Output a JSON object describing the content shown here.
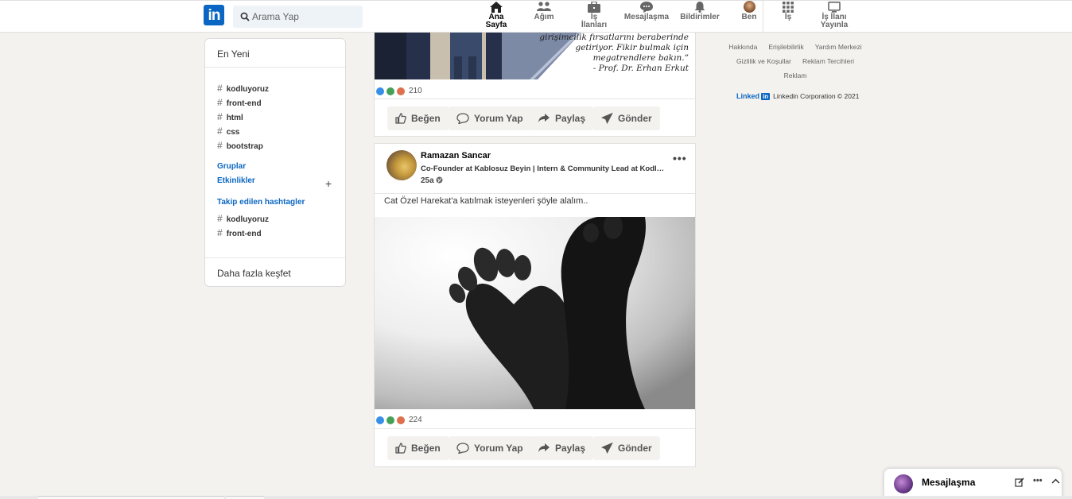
{
  "nav": {
    "logo": "in",
    "search_placeholder": "Arama Yap",
    "items": [
      {
        "label": "Ana Sayfa",
        "icon": "home-icon"
      },
      {
        "label": "Ağım",
        "icon": "network-icon"
      },
      {
        "label": "İş İlanları",
        "icon": "briefcase-icon"
      },
      {
        "label": "Mesajlaşma",
        "icon": "messaging-icon"
      },
      {
        "label": "Bildirimler",
        "icon": "bell-icon"
      },
      {
        "label": "Ben",
        "icon": "avatar"
      },
      {
        "label": "İş",
        "icon": "grid-icon"
      },
      {
        "label": "İş İlanı Yayınla",
        "icon": "post-job-icon"
      }
    ]
  },
  "sidebar": {
    "recent_label": "En Yeni",
    "recent_tags": [
      "kodluyoruz",
      "front-end",
      "html",
      "css",
      "bootstrap"
    ],
    "groups_label": "Gruplar",
    "events_label": "Etkinlikler",
    "followed_label": "Takip edilen hashtagler",
    "followed_tags": [
      "kodluyoruz",
      "front-end"
    ],
    "discover_label": "Daha fazla keşfet"
  },
  "post1": {
    "quote_lines": [
      "girişimcilik fırsatlarını beraberinde",
      "getiriyor. Fikir bulmak için",
      "megatrendlere bakın.”",
      "- Prof. Dr. Erhan Erkut"
    ],
    "reaction_count": "210"
  },
  "post2": {
    "author": "Ramazan Sancar",
    "headline": "Co-Founder at Kablosuz Beyin | Intern & Community Lead at Kodluyoruz",
    "time": "25a",
    "more": "•••",
    "text": "Cat Özel Harekat'a katılmak isteyenleri şöyle alalım..",
    "reaction_count": "224"
  },
  "actions": {
    "like": "Beğen",
    "comment": "Yorum Yap",
    "share": "Paylaş",
    "send": "Gönder"
  },
  "footer": {
    "row1": [
      "Hakkında",
      "Erişilebilirlik",
      "Yardım Merkezi"
    ],
    "row2": [
      "Gizlilik ve Koşullar",
      "Reklam Tercihleri"
    ],
    "row3": [
      "Reklam"
    ],
    "brand": "Linked",
    "brand_box": "in",
    "corp": "Linkedin Corporation © 2021"
  },
  "messaging": {
    "title": "Mesajlaşma"
  },
  "colors": {
    "brand": "#0a66c2",
    "background": "#f3f2ef"
  }
}
